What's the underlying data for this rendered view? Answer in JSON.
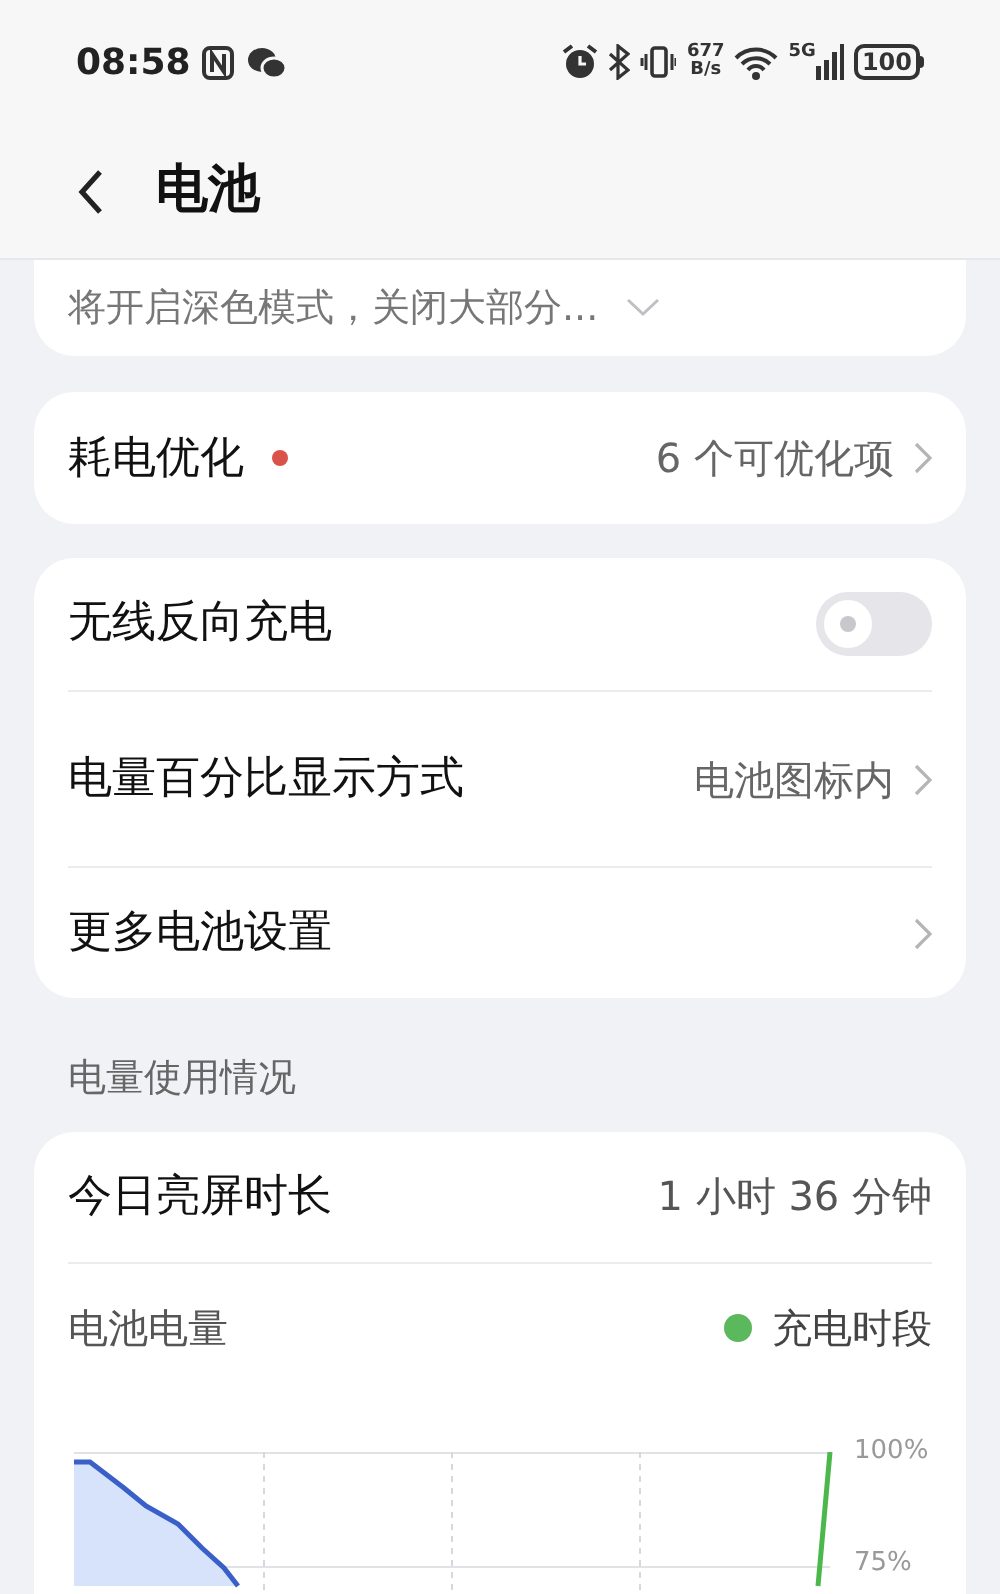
{
  "status_bar": {
    "time": "08:58",
    "net_speed_value": "677",
    "net_speed_unit": "B/s",
    "network_type": "5G",
    "battery": "100"
  },
  "header": {
    "title": "电池"
  },
  "partial_card": {
    "text": "将开启深色模式，关闭大部分..."
  },
  "optimization": {
    "label": "耗电优化",
    "badge": {
      "color": "#d9534a"
    },
    "value": "6 个可优化项"
  },
  "settings": [
    {
      "kind": "toggle",
      "label": "无线反向充电",
      "on": false
    },
    {
      "kind": "link",
      "label": "电量百分比显示方式",
      "value": "电池图标内"
    },
    {
      "kind": "link",
      "label": "更多电池设置"
    }
  ],
  "usage": {
    "section_title": "电量使用情况",
    "screen_time_label": "今日亮屏时长",
    "screen_time_value": "1 小时 36 分钟",
    "battery_label": "电池电量",
    "legend": {
      "label": "充电时段",
      "color": "#5cb85c"
    },
    "y_tick_labels": [
      "100%",
      "75%"
    ]
  }
}
